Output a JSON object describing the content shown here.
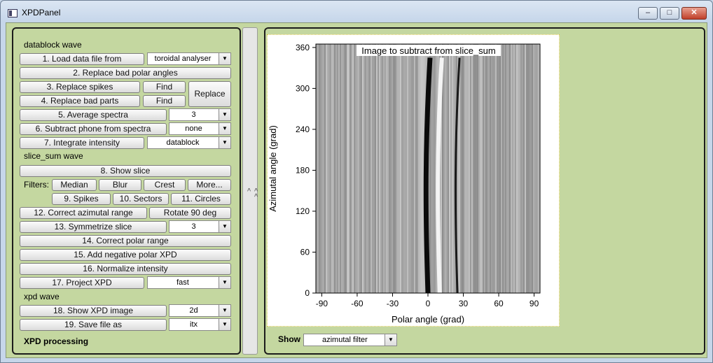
{
  "window": {
    "title": "XPDPanel",
    "minimize": "–",
    "maximize": "□",
    "close": "✕"
  },
  "left": {
    "sections": {
      "datablock": "datablock wave",
      "slice_sum": "slice_sum wave",
      "xpd": "xpd wave",
      "processing": "XPD processing"
    },
    "filters_label": "Filters:",
    "buttons": {
      "b1": "1. Load data file from",
      "b2": "2. Replace bad polar angles",
      "b3": "3. Replace spikes",
      "b3_find": "Find",
      "b4": "4. Replace bad parts",
      "b4_find": "Find",
      "replace": "Replace",
      "b5": "5. Average spectra",
      "b6": "6. Subtract phone from spectra",
      "b7": "7. Integrate intensity",
      "b8": "8. Show slice",
      "median": "Median",
      "blur": "Blur",
      "crest": "Crest",
      "more": "More...",
      "b9": "9. Spikes",
      "b10": "10. Sectors",
      "b11": "11. Circles",
      "b12": "12. Correct azimutal range",
      "rotate": "Rotate 90 deg",
      "b13": "13. Symmetrize slice",
      "b14": "14. Correct polar range",
      "b15": "15. Add negative polar XPD",
      "b16": "16. Normalize intensity",
      "b17": "17. Project XPD",
      "b18": "18. Show XPD image",
      "b19": "19. Save file as"
    },
    "selects": {
      "s1": "toroidal analyser",
      "s5": "3",
      "s6": "none",
      "s7": "datablock",
      "s13": "3",
      "s17": "fast",
      "s18": "2d",
      "s19": "itx"
    }
  },
  "splitter": {
    "glyph": "< < <"
  },
  "right": {
    "show_label": "Show",
    "show_value": "azimutal filter"
  },
  "chart_data": {
    "type": "heatmap",
    "title": "Image to subtract from slice_sum",
    "xlabel": "Polar angle (grad)",
    "ylabel": "Azimutal angle (grad)",
    "xlim": [
      -95,
      95
    ],
    "ylim": [
      0,
      365
    ],
    "xticks": [
      -90,
      -60,
      -30,
      0,
      30,
      60,
      90
    ],
    "yticks": [
      0,
      60,
      120,
      180,
      240,
      300,
      360
    ],
    "colormap": "grayscale",
    "features": [
      {
        "polar": 0,
        "azimuth_range": [
          0,
          345
        ],
        "intensity": "dark"
      },
      {
        "polar": 10,
        "azimuth_range": [
          0,
          345
        ],
        "intensity": "bright"
      },
      {
        "polar": 25,
        "azimuth_range": [
          0,
          345
        ],
        "intensity": "dark"
      }
    ]
  }
}
